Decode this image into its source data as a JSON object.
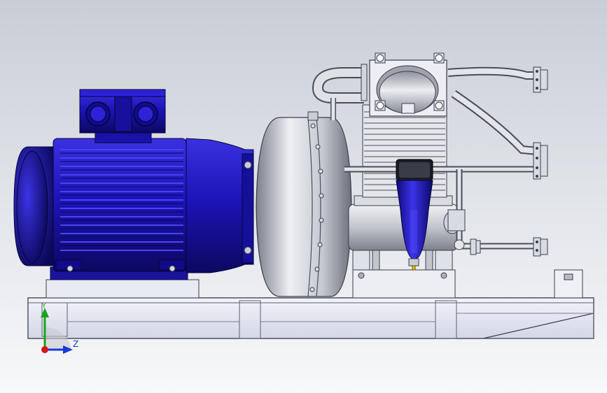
{
  "viewport": {
    "background_top": "#c9ced6",
    "background_bottom": "#f7f8fa"
  },
  "colors": {
    "motor_blue": "#1d14b8",
    "motor_blue_dark": "#0e0a6e",
    "steel": "#c9ccd4",
    "steel_dark": "#6d7280",
    "frame": "#e4e6f2",
    "filter_blue": "#2a1fd0",
    "axis_y": "#1aa31a",
    "axis_z": "#1a3ad6",
    "axis_origin": "#d01818"
  },
  "triad": {
    "y_label": "Y",
    "z_label": "Z"
  }
}
